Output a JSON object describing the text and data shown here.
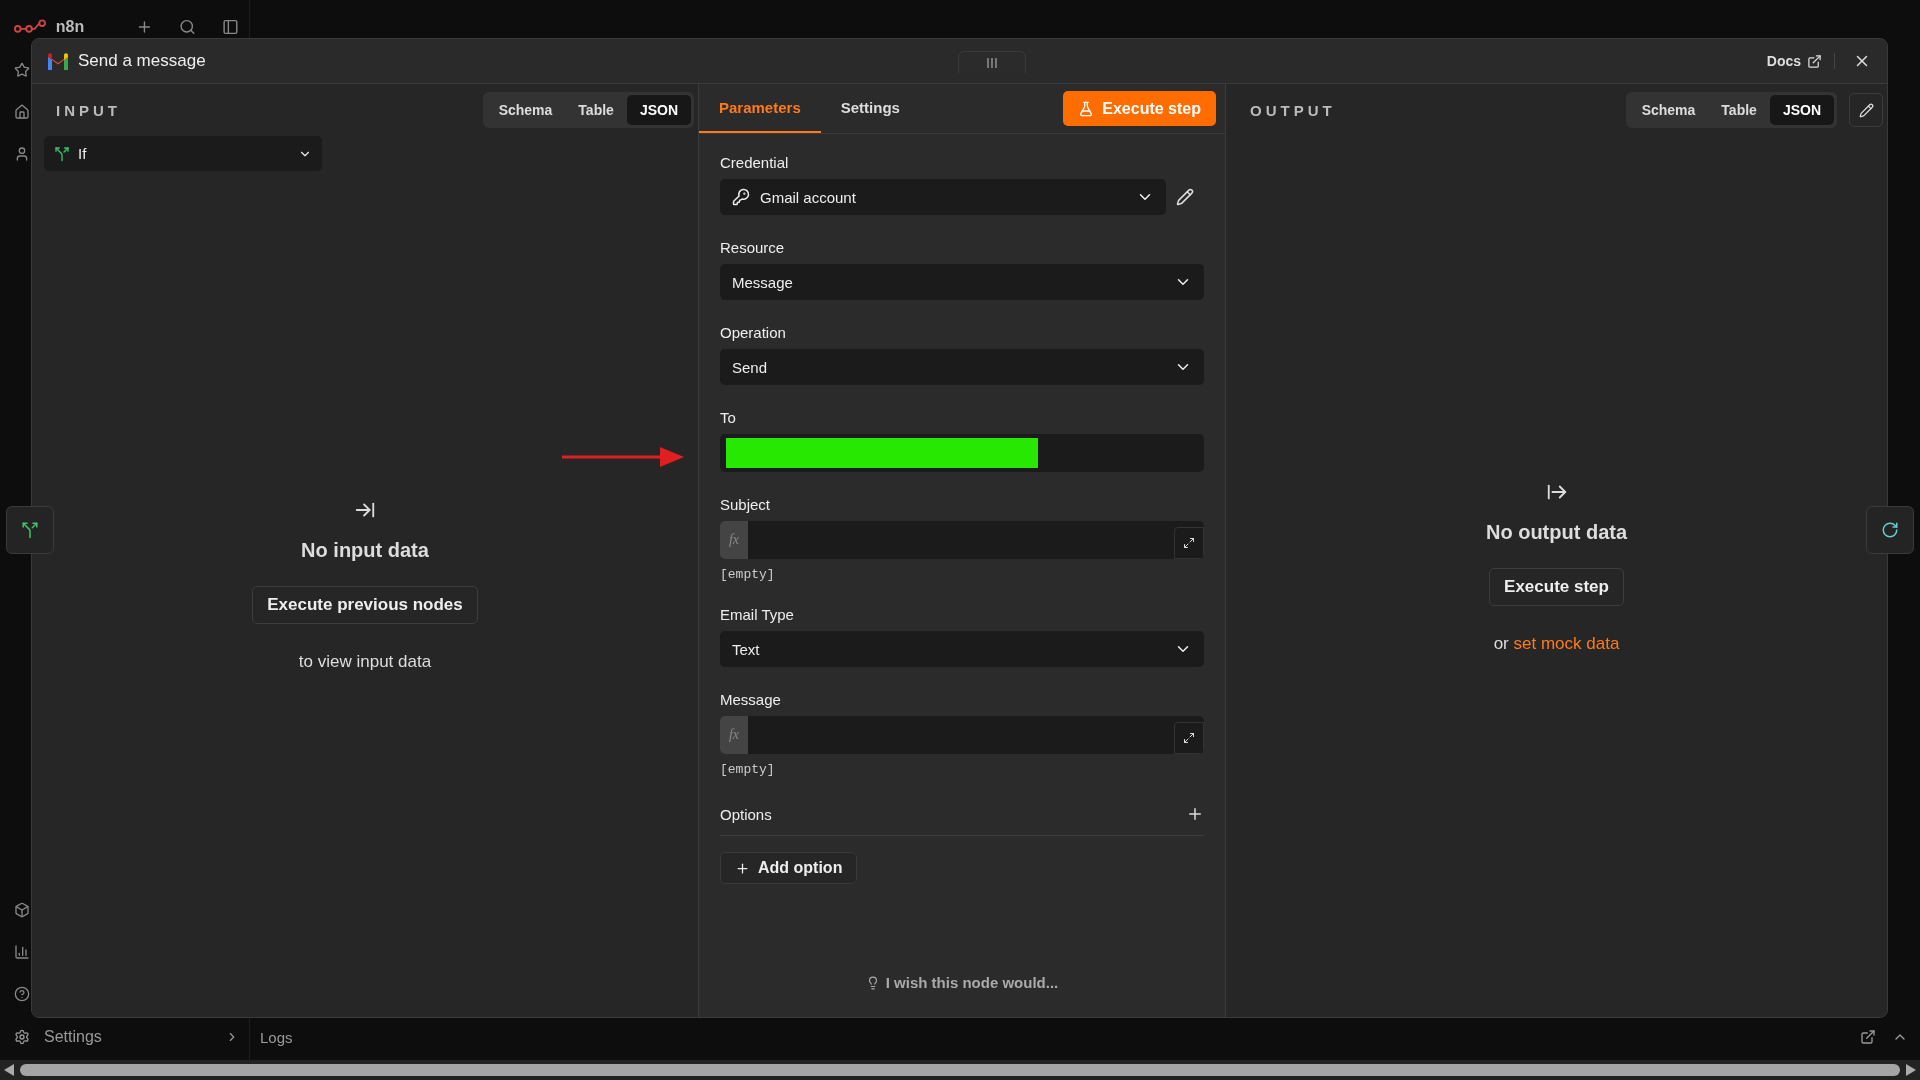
{
  "app": {
    "logo": "n8n",
    "settings": "Settings",
    "logs": "Logs"
  },
  "modal": {
    "title": "Send a message",
    "docs": "Docs"
  },
  "input": {
    "heading": "INPUT",
    "view_tabs": [
      {
        "label": "Schema",
        "selected": false
      },
      {
        "label": "Table",
        "selected": false
      },
      {
        "label": "JSON",
        "selected": true
      }
    ],
    "node_select": "If",
    "empty_title": "No input data",
    "button": "Execute previous nodes",
    "hint": "to view input data"
  },
  "params": {
    "tabs": [
      {
        "label": "Parameters",
        "selected": true
      },
      {
        "label": "Settings",
        "selected": false
      }
    ],
    "execute": "Execute step",
    "fields": [
      {
        "kind": "credential",
        "label": "Credential",
        "value": "Gmail account"
      },
      {
        "kind": "select",
        "label": "Resource",
        "value": "Message"
      },
      {
        "kind": "select",
        "label": "Operation",
        "value": "Send"
      },
      {
        "kind": "redacted",
        "label": "To"
      },
      {
        "kind": "expression",
        "label": "Subject",
        "badge": "fx",
        "hint": "[empty]"
      },
      {
        "kind": "select",
        "label": "Email Type",
        "value": "Text"
      },
      {
        "kind": "expression",
        "label": "Message",
        "badge": "fx",
        "hint": "[empty]"
      }
    ],
    "options_label": "Options",
    "add_option": "Add option",
    "feedback": "I wish this node would..."
  },
  "output": {
    "heading": "OUTPUT",
    "view_tabs": [
      {
        "label": "Schema",
        "selected": false
      },
      {
        "label": "Table",
        "selected": false
      },
      {
        "label": "JSON",
        "selected": true
      }
    ],
    "empty_title": "No output data",
    "button": "Execute step",
    "hint_prefix": "or",
    "hint_link": "set mock data"
  }
}
